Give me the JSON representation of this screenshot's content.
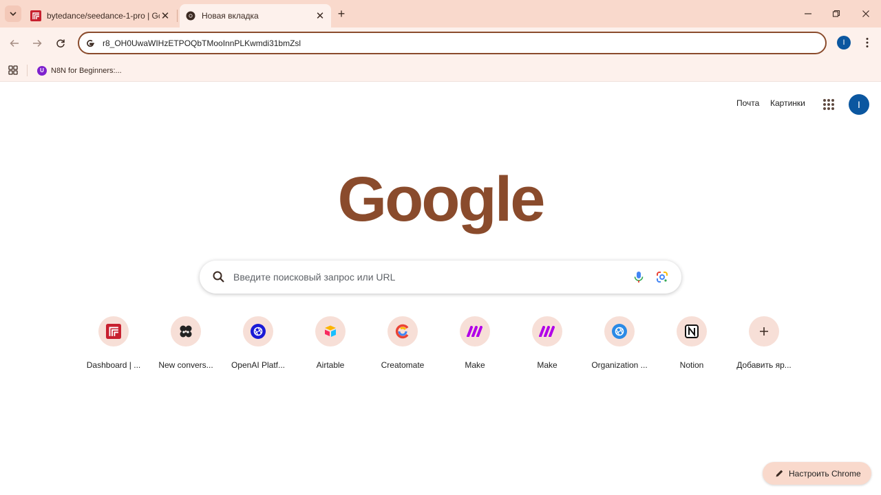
{
  "colors": {
    "tabstrip_bg": "#f9d9cc",
    "toolbar_bg": "#fdf1ec",
    "omnibox_border": "#8a4b2c",
    "logo": "#8a4b2c",
    "profile": "#0b57a0"
  },
  "tabs": [
    {
      "title": "bytedance/seedance-1-pro | Gc",
      "icon": "replicate-icon",
      "active": false
    },
    {
      "title": "Новая вкладка",
      "icon": "chrome-icon",
      "active": true
    }
  ],
  "toolbar": {
    "url": "r8_OH0UwaWIHzETPOQbTMooInnPLKwmdi31bmZsl",
    "profile_initial": "I"
  },
  "bookmarks": [
    {
      "label": "N8N for Beginners:...",
      "icon": "n8n-icon"
    }
  ],
  "page": {
    "links": {
      "mail": "Почта",
      "images": "Картинки"
    },
    "avatar_initial": "I",
    "logo_text": "Google",
    "search_placeholder": "Введите поисковый запрос или URL",
    "customize_label": "Настроить Chrome"
  },
  "shortcuts": [
    {
      "label": "Dashboard | ...",
      "icon": "replicate-icon"
    },
    {
      "label": "New convers...",
      "icon": "bot-icon"
    },
    {
      "label": "OpenAI Platf...",
      "icon": "openai-icon"
    },
    {
      "label": "Airtable",
      "icon": "airtable-icon"
    },
    {
      "label": "Creatomate",
      "icon": "creatomate-icon"
    },
    {
      "label": "Make",
      "icon": "make-icon"
    },
    {
      "label": "Make",
      "icon": "make-icon"
    },
    {
      "label": "Organization ...",
      "icon": "openai-icon"
    },
    {
      "label": "Notion",
      "icon": "notion-icon"
    },
    {
      "label": "Добавить яр...",
      "icon": "plus-icon"
    }
  ]
}
